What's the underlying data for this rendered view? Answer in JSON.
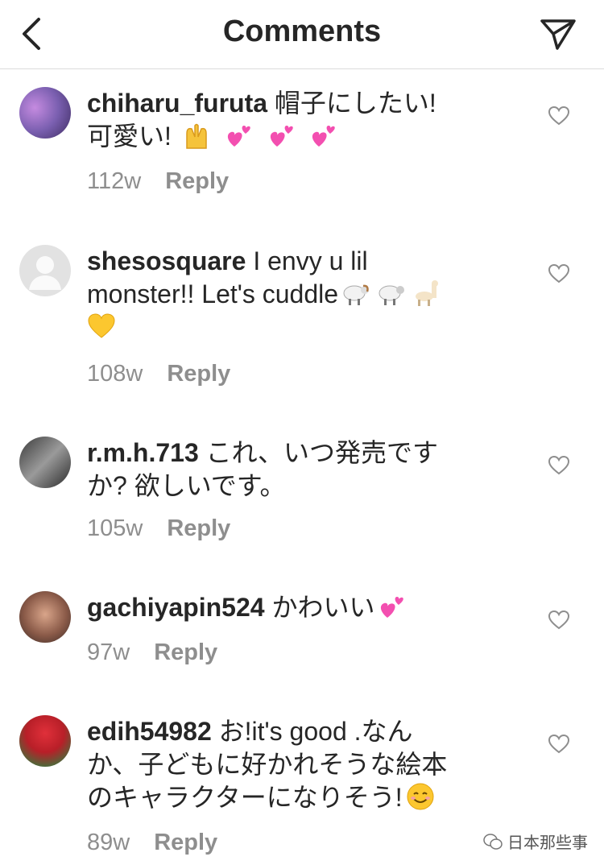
{
  "header": {
    "title": "Comments"
  },
  "comments": [
    {
      "user": "chiharu_furuta",
      "line1": "帽子にしたい!",
      "line2": "可愛い!",
      "time": "112w",
      "reply": "Reply"
    },
    {
      "user": "shesosquare",
      "line1": "I envy u lil",
      "line2": "monster!! Let's cuddle",
      "time": "108w",
      "reply": "Reply"
    },
    {
      "user": "r.m.h.713",
      "line1": "これ、いつ発売です",
      "line2": "か? 欲しいです。",
      "time": "105w",
      "reply": "Reply"
    },
    {
      "user": "gachiyapin524",
      "line1": "かわいい",
      "time": "97w",
      "reply": "Reply"
    },
    {
      "user": "edih54982",
      "line1": "お!it's good .なん",
      "line2": "か、子どもに好かれそうな絵本",
      "line3": "のキャラクターになりそう!",
      "time": "89w",
      "reply": "Reply"
    }
  ],
  "watermark": {
    "text": "日本那些事"
  },
  "icons": {
    "back": "chevron-left-icon",
    "send": "paper-plane-icon",
    "heart": "heart-outline-icon"
  },
  "colors": {
    "text": "#262626",
    "meta": "#8e8e8e",
    "divider": "#dbdbdb"
  }
}
